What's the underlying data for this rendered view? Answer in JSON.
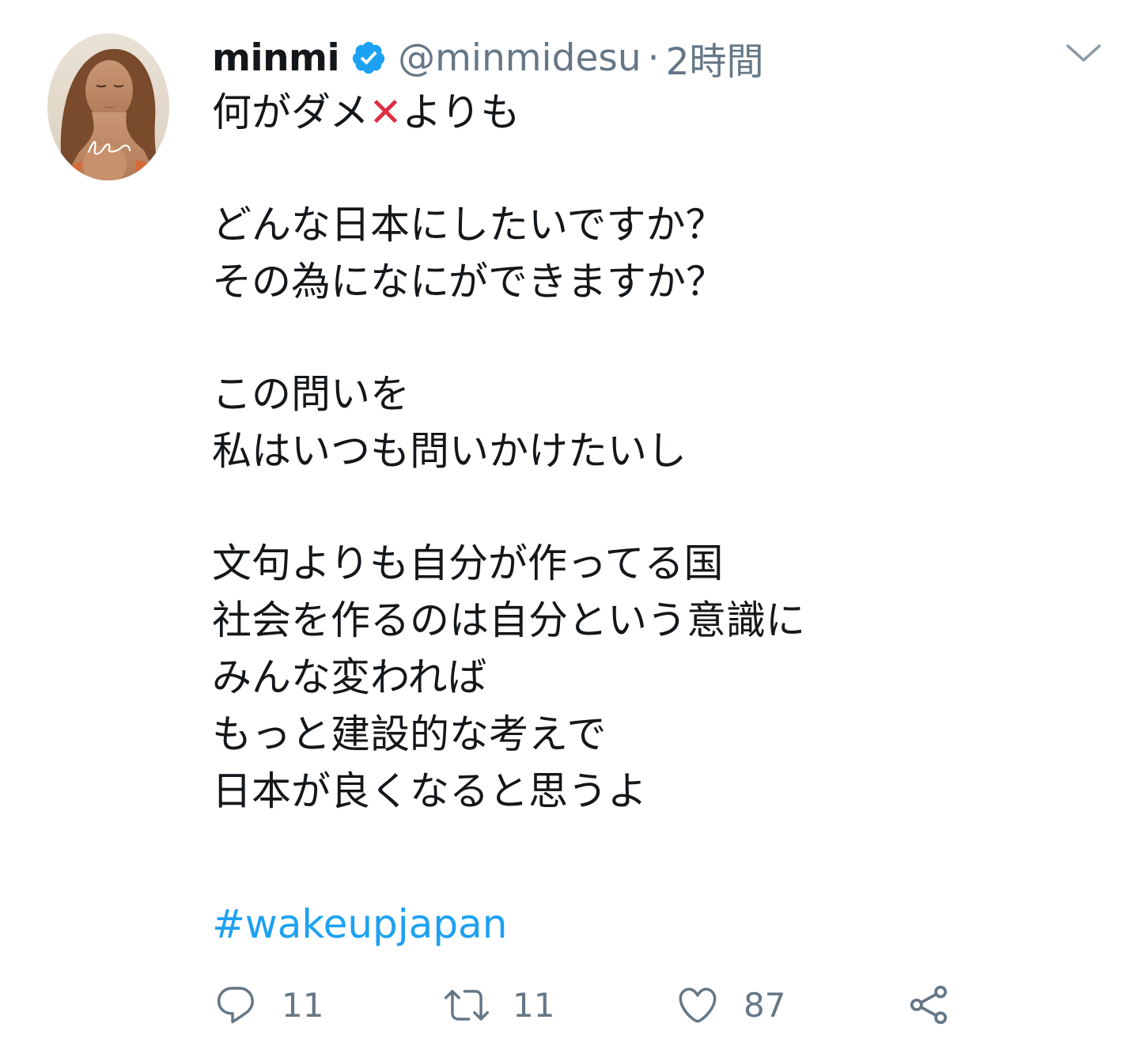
{
  "tweet": {
    "author": {
      "display_name": "minmi",
      "handle": "@minmidesu",
      "verified": true
    },
    "separator": "·",
    "timestamp": "2時間",
    "text_lines": {
      "l1a": "何がダメ",
      "l1_emoji": "✕",
      "l1b": "よりも",
      "l2": "どんな日本にしたいですか？",
      "l3": "その為になにができますか？",
      "l4": "この問いを",
      "l5": "私はいつも問いかけたいし",
      "l6": "文句よりも自分が作ってる国",
      "l7": "社会を作るのは自分という意識に",
      "l8": "みんな変われば",
      "l9": "もっと建設的な考えで",
      "l10": "日本が良くなると思うよ"
    },
    "hashtag": "#wakeupjapan"
  },
  "actions": {
    "reply_count": "11",
    "retweet_count": "11",
    "like_count": "87"
  },
  "icons": {
    "reply": "reply-icon",
    "retweet": "retweet-icon",
    "like": "heart-icon",
    "share": "share-icon",
    "more": "chevron-down-icon",
    "verified": "verified-badge-icon"
  },
  "colors": {
    "link": "#1da1f2",
    "secondary_text": "#657786",
    "primary_text": "#14171a",
    "verified_badge": "#1da1f2"
  }
}
